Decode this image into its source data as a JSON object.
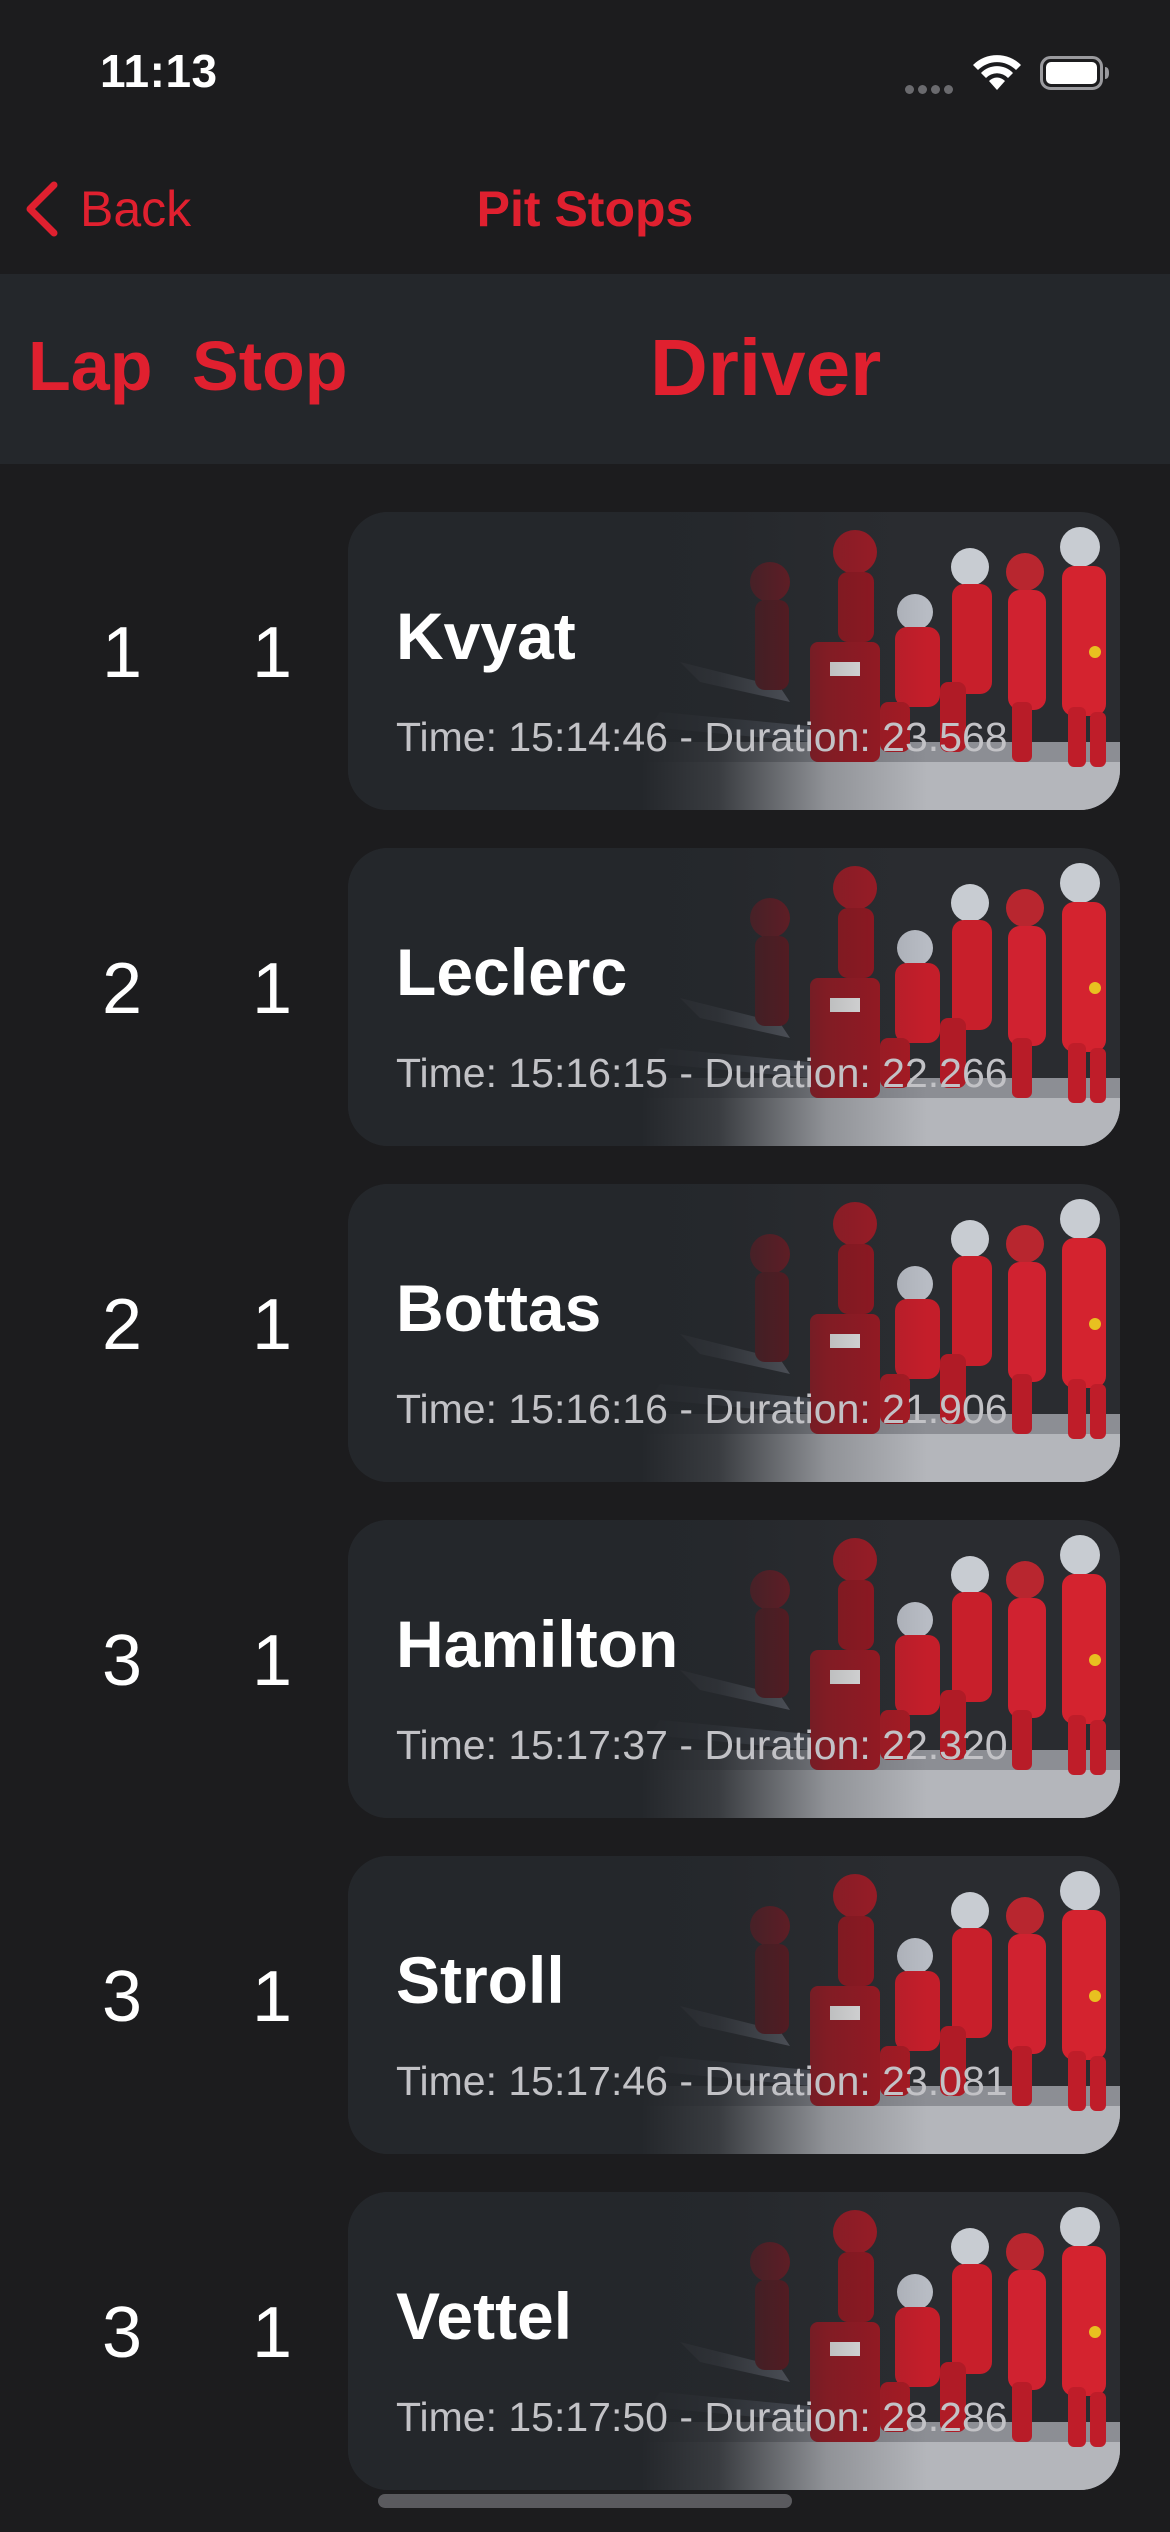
{
  "status_bar": {
    "time": "11:13"
  },
  "nav": {
    "back_label": "Back",
    "title": "Pit Stops"
  },
  "table_header": {
    "lap": "Lap",
    "stop": "Stop",
    "driver": "Driver"
  },
  "colors": {
    "accent": "#e0202f",
    "background": "#1c1c1e",
    "card": "#24272b"
  },
  "rows": [
    {
      "lap": "1",
      "stop": "1",
      "driver": "Kvyat",
      "detail": "Time: 15:14:46 - Duration: 23.568"
    },
    {
      "lap": "2",
      "stop": "1",
      "driver": "Leclerc",
      "detail": "Time: 15:16:15 - Duration: 22.266"
    },
    {
      "lap": "2",
      "stop": "1",
      "driver": "Bottas",
      "detail": "Time: 15:16:16 - Duration: 21.906"
    },
    {
      "lap": "3",
      "stop": "1",
      "driver": "Hamilton",
      "detail": "Time: 15:17:37 - Duration: 22.320"
    },
    {
      "lap": "3",
      "stop": "1",
      "driver": "Stroll",
      "detail": "Time: 15:17:46 - Duration: 23.081"
    },
    {
      "lap": "3",
      "stop": "1",
      "driver": "Vettel",
      "detail": "Time: 15:17:50 - Duration: 28.286"
    }
  ]
}
